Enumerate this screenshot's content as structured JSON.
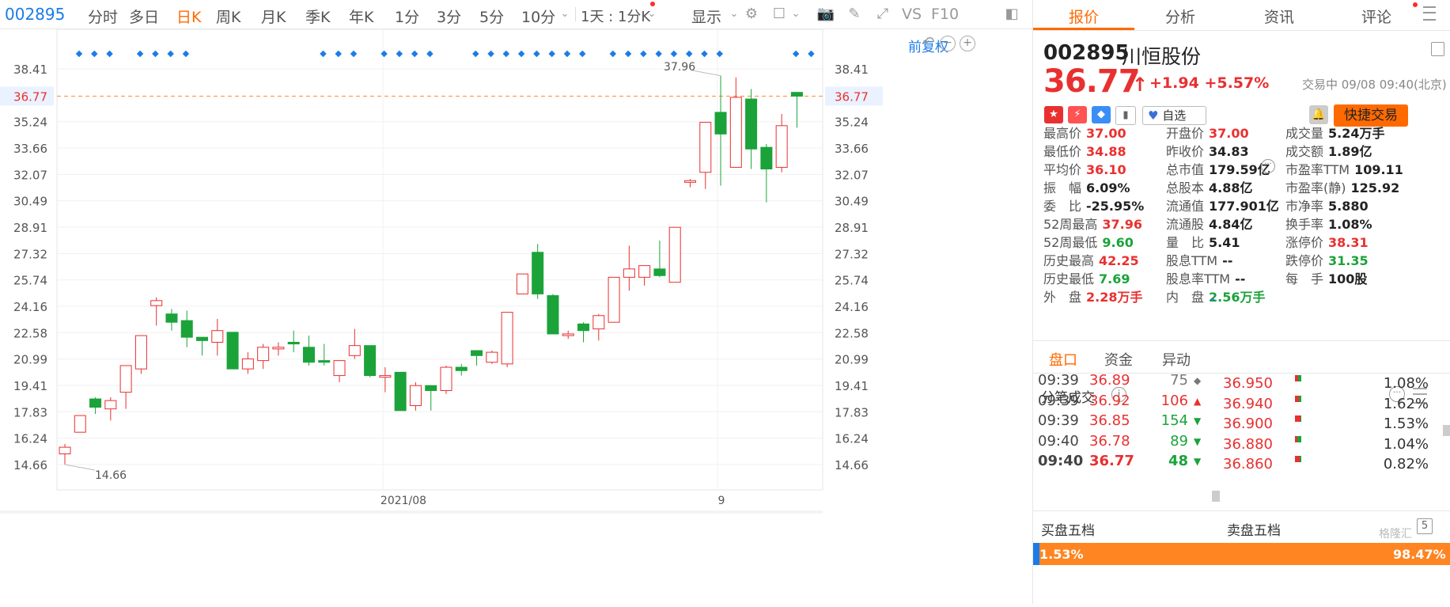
{
  "toolbar": {
    "code": "002895",
    "items": [
      "分时",
      "多日",
      "日K",
      "周K",
      "月K",
      "季K",
      "年K",
      "1分",
      "3分",
      "5分",
      "10分"
    ],
    "period_select": "1天 : 1分K",
    "display_label": "显示",
    "vs_label": "VS",
    "f10_label": "F10"
  },
  "chart": {
    "adjust_label": "前复权",
    "y_ticks": [
      "38.41",
      "36.77",
      "35.24",
      "33.66",
      "32.07",
      "30.49",
      "28.91",
      "27.32",
      "25.74",
      "24.16",
      "22.58",
      "20.99",
      "19.41",
      "17.83",
      "16.24",
      "14.66"
    ],
    "current_price_label": "36.77",
    "high_annotation": "37.96",
    "low_annotation": "14.66",
    "x_labels": [
      "2021/08",
      "9"
    ],
    "colors": {
      "up": "#e93030",
      "down": "#1ba33a",
      "dash": "#ff8a3d",
      "marker": "#1b7ce8"
    }
  },
  "chart_data": {
    "type": "candlestick",
    "ylim": [
      14.66,
      38.41
    ],
    "candles": [
      {
        "o": 15.3,
        "c": 15.7,
        "h": 15.9,
        "l": 14.66
      },
      {
        "o": 16.6,
        "c": 17.6,
        "h": 17.6,
        "l": 16.6
      },
      {
        "o": 18.6,
        "c": 18.1,
        "h": 18.7,
        "l": 17.7
      },
      {
        "o": 18.0,
        "c": 18.5,
        "h": 18.7,
        "l": 17.3
      },
      {
        "o": 19.0,
        "c": 20.6,
        "h": 20.6,
        "l": 18.0
      },
      {
        "o": 20.4,
        "c": 22.4,
        "h": 22.4,
        "l": 20.1
      },
      {
        "o": 24.2,
        "c": 24.5,
        "h": 24.7,
        "l": 23.0
      },
      {
        "o": 23.7,
        "c": 23.2,
        "h": 24.0,
        "l": 22.7
      },
      {
        "o": 23.3,
        "c": 22.3,
        "h": 23.9,
        "l": 21.7
      },
      {
        "o": 22.3,
        "c": 22.1,
        "h": 22.3,
        "l": 21.2
      },
      {
        "o": 22.0,
        "c": 22.7,
        "h": 23.4,
        "l": 21.2
      },
      {
        "o": 22.6,
        "c": 20.4,
        "h": 22.6,
        "l": 20.4
      },
      {
        "o": 20.4,
        "c": 21.0,
        "h": 21.4,
        "l": 20.1
      },
      {
        "o": 20.9,
        "c": 21.7,
        "h": 21.9,
        "l": 20.4
      },
      {
        "o": 21.6,
        "c": 21.7,
        "h": 22.0,
        "l": 21.2
      },
      {
        "o": 22.0,
        "c": 21.9,
        "h": 22.7,
        "l": 21.4
      },
      {
        "o": 21.7,
        "c": 20.8,
        "h": 22.4,
        "l": 20.6
      },
      {
        "o": 20.9,
        "c": 20.8,
        "h": 21.9,
        "l": 20.6
      },
      {
        "o": 20.0,
        "c": 20.9,
        "h": 20.9,
        "l": 19.6
      },
      {
        "o": 21.2,
        "c": 21.8,
        "h": 22.8,
        "l": 21.0
      },
      {
        "o": 21.8,
        "c": 20.0,
        "h": 21.8,
        "l": 19.9
      },
      {
        "o": 19.9,
        "c": 20.0,
        "h": 20.5,
        "l": 19.0
      },
      {
        "o": 20.2,
        "c": 17.9,
        "h": 20.2,
        "l": 17.9
      },
      {
        "o": 18.2,
        "c": 19.4,
        "h": 19.6,
        "l": 17.9
      },
      {
        "o": 19.4,
        "c": 19.1,
        "h": 19.4,
        "l": 17.9
      },
      {
        "o": 19.1,
        "c": 20.5,
        "h": 20.6,
        "l": 18.9
      },
      {
        "o": 20.5,
        "c": 20.3,
        "h": 20.7,
        "l": 20.0
      },
      {
        "o": 21.5,
        "c": 21.2,
        "h": 21.5,
        "l": 20.6
      },
      {
        "o": 20.8,
        "c": 21.4,
        "h": 21.5,
        "l": 20.7
      },
      {
        "o": 20.7,
        "c": 23.8,
        "h": 23.8,
        "l": 20.5
      },
      {
        "o": 24.9,
        "c": 26.1,
        "h": 26.1,
        "l": 24.9
      },
      {
        "o": 27.4,
        "c": 24.9,
        "h": 27.9,
        "l": 24.6
      },
      {
        "o": 24.8,
        "c": 22.5,
        "h": 24.9,
        "l": 22.5
      },
      {
        "o": 22.4,
        "c": 22.5,
        "h": 22.7,
        "l": 22.2
      },
      {
        "o": 23.1,
        "c": 22.7,
        "h": 23.2,
        "l": 22.0
      },
      {
        "o": 22.8,
        "c": 23.6,
        "h": 23.7,
        "l": 22.1
      },
      {
        "o": 23.2,
        "c": 25.9,
        "h": 25.9,
        "l": 23.2
      },
      {
        "o": 25.9,
        "c": 26.4,
        "h": 27.8,
        "l": 25.1
      },
      {
        "o": 25.9,
        "c": 26.6,
        "h": 26.6,
        "l": 25.4
      },
      {
        "o": 26.4,
        "c": 26.0,
        "h": 28.1,
        "l": 25.9
      },
      {
        "o": 25.6,
        "c": 28.9,
        "h": 28.9,
        "l": 25.6
      },
      {
        "o": 31.6,
        "c": 31.7,
        "h": 31.8,
        "l": 31.3
      },
      {
        "o": 32.2,
        "c": 35.2,
        "h": 35.2,
        "l": 31.2
      },
      {
        "o": 35.8,
        "c": 34.5,
        "h": 38.0,
        "l": 31.4
      },
      {
        "o": 32.5,
        "c": 36.7,
        "h": 37.9,
        "l": 32.5
      },
      {
        "o": 36.6,
        "c": 33.6,
        "h": 37.2,
        "l": 32.4
      },
      {
        "o": 33.7,
        "c": 32.4,
        "h": 33.9,
        "l": 30.4
      },
      {
        "o": 32.5,
        "c": 35.0,
        "h": 35.7,
        "l": 32.2
      },
      {
        "o": 37.0,
        "c": 36.77,
        "h": 37.0,
        "l": 34.88
      }
    ]
  },
  "panel": {
    "tabs": [
      "报价",
      "分析",
      "资讯",
      "评论"
    ],
    "code": "002895",
    "name": "川恒股份",
    "price": "36.77",
    "change": "+1.94",
    "change_pct": "+5.57%",
    "trade_status": "交易中 09/08 09:40(北京)",
    "watch_label": "自选",
    "quick_trade_label": "快捷交易",
    "stats": [
      [
        {
          "k": "最高价",
          "v": "37.00",
          "c": "red"
        },
        {
          "k": "开盘价",
          "v": "37.00",
          "c": "red"
        },
        {
          "k": "成交量",
          "v": "5.24万手",
          "c": "dark"
        }
      ],
      [
        {
          "k": "最低价",
          "v": "34.88",
          "c": "red"
        },
        {
          "k": "昨收价",
          "v": "34.83",
          "c": "dark"
        },
        {
          "k": "成交额",
          "v": "1.89亿",
          "c": "dark"
        }
      ],
      [
        {
          "k": "平均价",
          "v": "36.10",
          "c": "red"
        },
        {
          "k": "总市值",
          "v": "179.59亿",
          "c": "dark"
        },
        {
          "k": "市盈率TTM",
          "v": "109.11",
          "c": "dark"
        }
      ],
      [
        {
          "k": "振　幅",
          "v": "6.09%",
          "c": "dark"
        },
        {
          "k": "总股本",
          "v": "4.88亿",
          "c": "dark"
        },
        {
          "k": "市盈率(静)",
          "v": "125.92",
          "c": "dark"
        }
      ],
      [
        {
          "k": "委　比",
          "v": "-25.95%",
          "c": "dark"
        },
        {
          "k": "流通值",
          "v": "177.901亿",
          "c": "dark"
        },
        {
          "k": "市净率",
          "v": "5.880",
          "c": "dark"
        }
      ],
      [
        {
          "k": "52周最高",
          "v": "37.96",
          "c": "red"
        },
        {
          "k": "流通股",
          "v": "4.84亿",
          "c": "dark"
        },
        {
          "k": "换手率",
          "v": "1.08%",
          "c": "dark"
        }
      ],
      [
        {
          "k": "52周最低",
          "v": "9.60",
          "c": "green"
        },
        {
          "k": "量　比",
          "v": "5.41",
          "c": "dark"
        },
        {
          "k": "涨停价",
          "v": "38.31",
          "c": "red"
        }
      ],
      [
        {
          "k": "历史最高",
          "v": "42.25",
          "c": "red"
        },
        {
          "k": "股息TTM",
          "v": "--",
          "c": "dark"
        },
        {
          "k": "跌停价",
          "v": "31.35",
          "c": "green"
        }
      ],
      [
        {
          "k": "历史最低",
          "v": "7.69",
          "c": "green"
        },
        {
          "k": "股息率TTM",
          "v": "--",
          "c": "dark"
        },
        {
          "k": "每　手",
          "v": "100股",
          "c": "dark"
        }
      ],
      [
        {
          "k": "外　盘",
          "v": "2.28万手",
          "c": "red"
        },
        {
          "k": "内　盘",
          "v": "2.56万手",
          "c": "green"
        }
      ]
    ],
    "subtabs": [
      "盘口",
      "资金",
      "异动"
    ],
    "ticks_title": "分笔成交",
    "ticks": [
      {
        "time": "09:39",
        "price": "36.89",
        "vol": "75",
        "dir": "flat"
      },
      {
        "time": "09:39",
        "price": "36.92",
        "vol": "106",
        "dir": "up"
      },
      {
        "time": "09:39",
        "price": "36.85",
        "vol": "154",
        "dir": "down"
      },
      {
        "time": "09:40",
        "price": "36.78",
        "vol": "89",
        "dir": "down"
      },
      {
        "time": "09:40",
        "price": "36.77",
        "vol": "48",
        "dir": "down"
      }
    ],
    "levels": [
      {
        "price": "36.950",
        "pct": "1.08%",
        "split": 0.5
      },
      {
        "price": "36.940",
        "pct": "1.62%",
        "split": 0.4
      },
      {
        "price": "36.900",
        "pct": "1.53%",
        "split": 0.1
      },
      {
        "price": "36.880",
        "pct": "1.04%",
        "split": 0.6
      },
      {
        "price": "36.860",
        "pct": "0.82%",
        "split": 0.2
      }
    ],
    "buy_label": "买盘五档",
    "sell_label": "卖盘五档",
    "five_label": "5",
    "buy_pct": "1.53%",
    "sell_pct": "98.47%",
    "buy_fraction": 0.0153,
    "watermark": "格隆汇"
  }
}
